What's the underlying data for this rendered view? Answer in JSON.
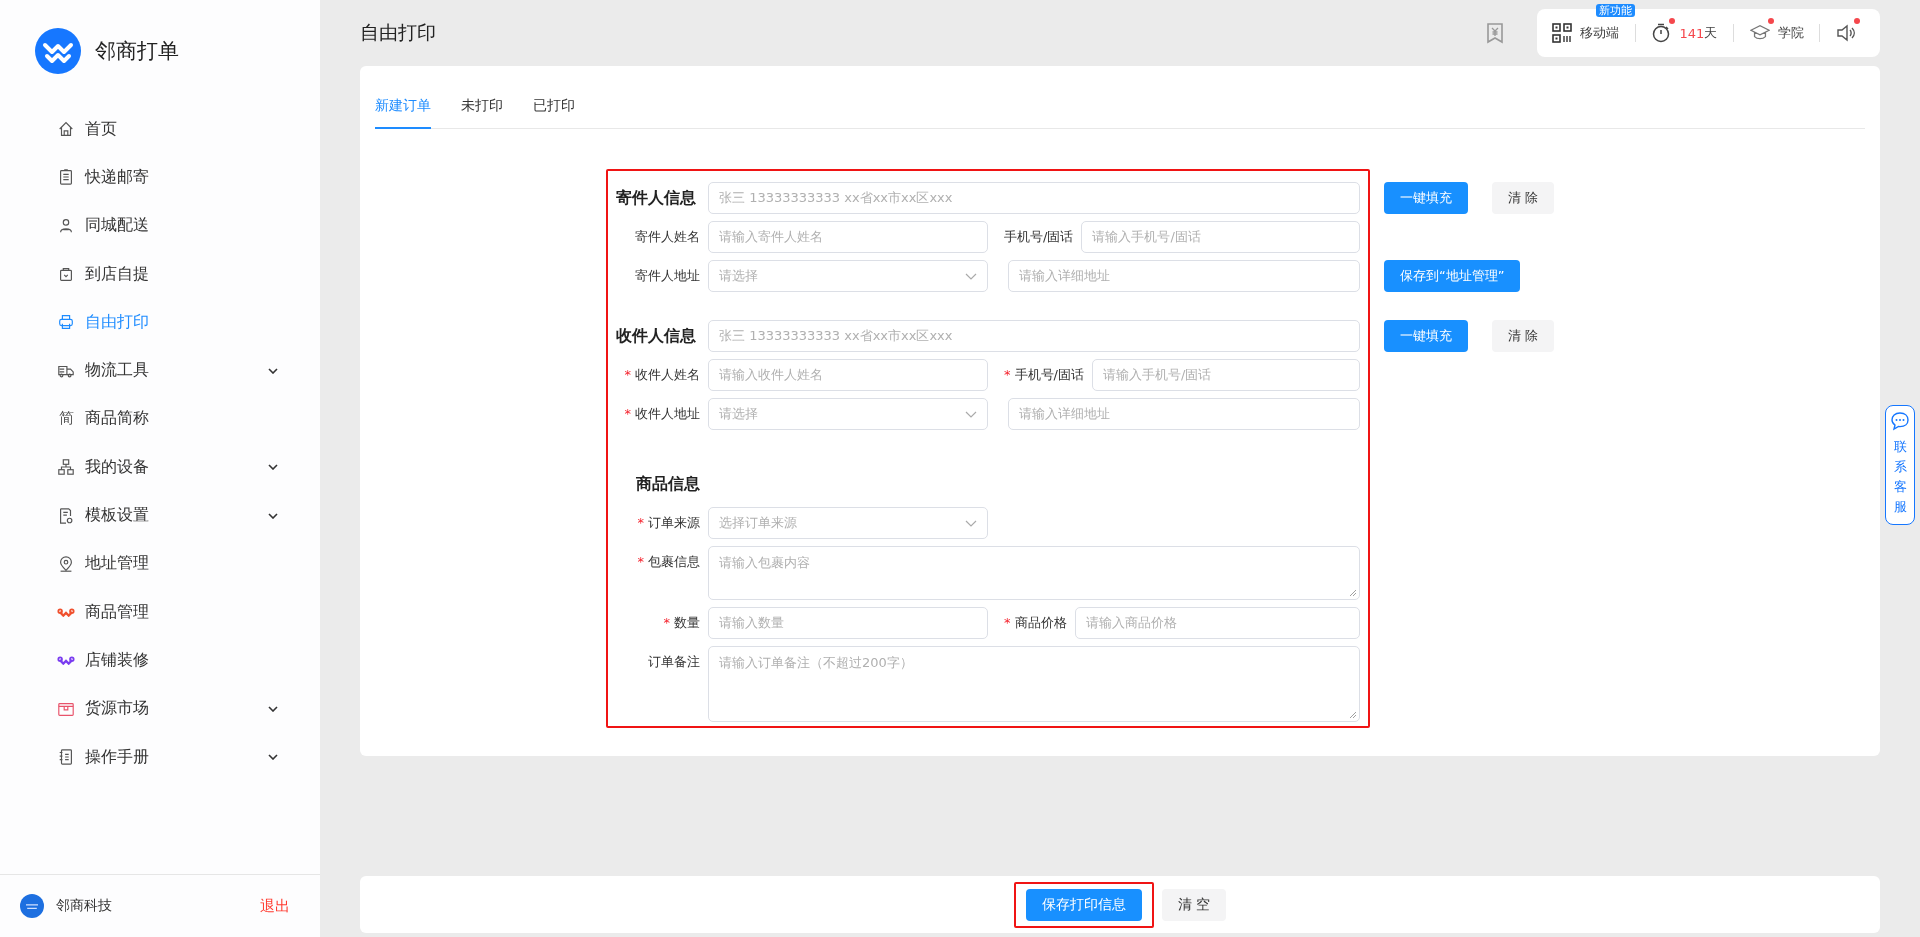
{
  "app": {
    "name": "邻商打单"
  },
  "sidebar": {
    "items": [
      {
        "label": "首页",
        "selected": false,
        "kind": "link"
      },
      {
        "label": "快递邮寄",
        "selected": false,
        "kind": "link"
      },
      {
        "label": "同城配送",
        "selected": false,
        "kind": "link"
      },
      {
        "label": "到店自提",
        "selected": false,
        "kind": "link"
      },
      {
        "label": "自由打印",
        "selected": true,
        "kind": "link"
      },
      {
        "label": "物流工具",
        "selected": false,
        "kind": "group"
      },
      {
        "label": "商品简称",
        "selected": false,
        "kind": "link",
        "glyph": "简"
      },
      {
        "label": "我的设备",
        "selected": false,
        "kind": "group"
      },
      {
        "label": "模板设置",
        "selected": false,
        "kind": "group"
      },
      {
        "label": "地址管理",
        "selected": false,
        "kind": "link"
      },
      {
        "label": "商品管理",
        "selected": false,
        "kind": "link"
      },
      {
        "label": "店铺装修",
        "selected": false,
        "kind": "link"
      },
      {
        "label": "货源市场",
        "selected": false,
        "kind": "group"
      },
      {
        "label": "操作手册",
        "selected": false,
        "kind": "group"
      }
    ],
    "user": "邻商科技",
    "logout": "退出"
  },
  "header": {
    "title": "自由打印",
    "tools": [
      {
        "kind": "qr",
        "label": "移动端",
        "badge": "新功能"
      },
      {
        "kind": "timer",
        "value": "141",
        "unit": "天",
        "dot": true
      },
      {
        "kind": "academy",
        "label": "学院",
        "dot": true
      },
      {
        "kind": "sound",
        "dot": true
      }
    ]
  },
  "tabs": [
    {
      "label": "新建订单",
      "selected": true
    },
    {
      "label": "未打印",
      "selected": false
    },
    {
      "label": "已打印",
      "selected": false
    }
  ],
  "form": {
    "sections": [
      {
        "title": "寄件人信息",
        "quick": {
          "placeholder": "张三 13333333333 xx省xx市xx区xxx",
          "actions": [
            {
              "label": "一键填充",
              "kind": "primary"
            },
            {
              "label": "清 除",
              "kind": "plain"
            }
          ]
        },
        "rows": [
          {
            "fields": [
              {
                "label": "寄件人姓名",
                "placeholder": "请输入寄件人姓名",
                "kind": "input"
              },
              {
                "label": "手机号/固话",
                "placeholder": "请输入手机号/固话",
                "kind": "input"
              }
            ]
          },
          {
            "fields": [
              {
                "label": "寄件人地址",
                "placeholder": "请选择",
                "kind": "select"
              },
              {
                "placeholder": "请输入详细地址",
                "kind": "input"
              }
            ],
            "actions": [
              {
                "label": "保存到“地址管理”",
                "kind": "primary"
              }
            ]
          }
        ]
      },
      {
        "title": "收件人信息",
        "quick": {
          "placeholder": "张三 13333333333 xx省xx市xx区xxx",
          "actions": [
            {
              "label": "一键填充",
              "kind": "primary"
            },
            {
              "label": "清 除",
              "kind": "plain"
            }
          ]
        },
        "rows": [
          {
            "fields": [
              {
                "required_mark": "*",
                "label": "收件人姓名",
                "placeholder": "请输入收件人姓名",
                "kind": "input"
              },
              {
                "required_mark": "*",
                "label": "手机号/固话",
                "placeholder": "请输入手机号/固话",
                "kind": "input"
              }
            ]
          },
          {
            "fields": [
              {
                "required_mark": "*",
                "label": "收件人地址",
                "placeholder": "请选择",
                "kind": "select"
              },
              {
                "placeholder": "请输入详细地址",
                "kind": "input"
              }
            ]
          }
        ]
      },
      {
        "title": "商品信息",
        "rows": [
          {
            "fields": [
              {
                "required_mark": "*",
                "label": "订单来源",
                "placeholder": "选择订单来源",
                "kind": "select"
              }
            ]
          },
          {
            "fields": [
              {
                "required_mark": "*",
                "label": "包裹信息",
                "placeholder": "请输入包裹内容",
                "kind": "textarea"
              }
            ]
          },
          {
            "fields": [
              {
                "required_mark": "*",
                "label": "数量",
                "placeholder": "请输入数量",
                "kind": "input"
              },
              {
                "required_mark": "*",
                "label": "商品价格",
                "placeholder": "请输入商品价格",
                "kind": "input"
              }
            ]
          },
          {
            "fields": [
              {
                "label": "订单备注",
                "placeholder": "请输入订单备注（不超过200字）",
                "kind": "note"
              }
            ]
          }
        ]
      }
    ]
  },
  "footer_buttons": [
    {
      "label": "保存打印信息",
      "kind": "primary"
    },
    {
      "label": "清 空",
      "kind": "plain"
    }
  ],
  "contact": {
    "label": "联系客服"
  }
}
